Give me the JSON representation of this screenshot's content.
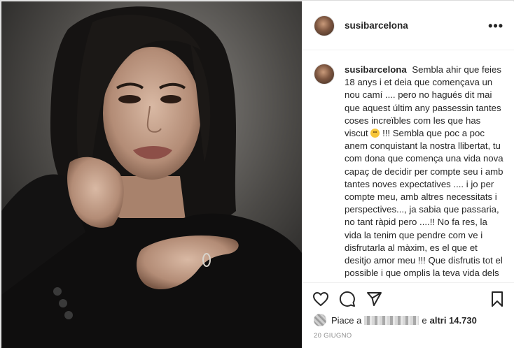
{
  "post": {
    "username": "susibarcelona",
    "more_label": "•••",
    "caption": {
      "username": "susibarcelona",
      "text_before_emoji": "Sembla ahir que feies 18 anys i et deia que començava un nou camí .... pero no hagués dit mai que aquest últim any passessin tantes coses increïbles com les que has viscut",
      "text_after_emoji": "!!! Sembla que poc a poc anem conquistant la nostra llibertat, tu com dona que comença una vida nova capaç de decidir per compte seu i amb tantes noves expectatives .... i jo per compte meu, amb altres necessitats i perspectives..., ja sabia que passaria, no tant ràpid pero ....!! No fa res, la vida la tenim que pendre com ve i disfrutarla al màxim, es el que et desitjo amor meu !!! Que disfrutis tot el possible i que omplis la teva vida dels millors records, de coses.que t'omplin de joia, noves, maques, emocionants"
    },
    "likes": {
      "prefix": "Piace a",
      "middle": "e",
      "others_label": "altri 14.730"
    },
    "date": "20 GIUGNO",
    "icons": {
      "like": "heart-icon",
      "comment": "comment-icon",
      "share": "share-icon",
      "save": "bookmark-icon",
      "more": "more-dots-icon"
    }
  }
}
